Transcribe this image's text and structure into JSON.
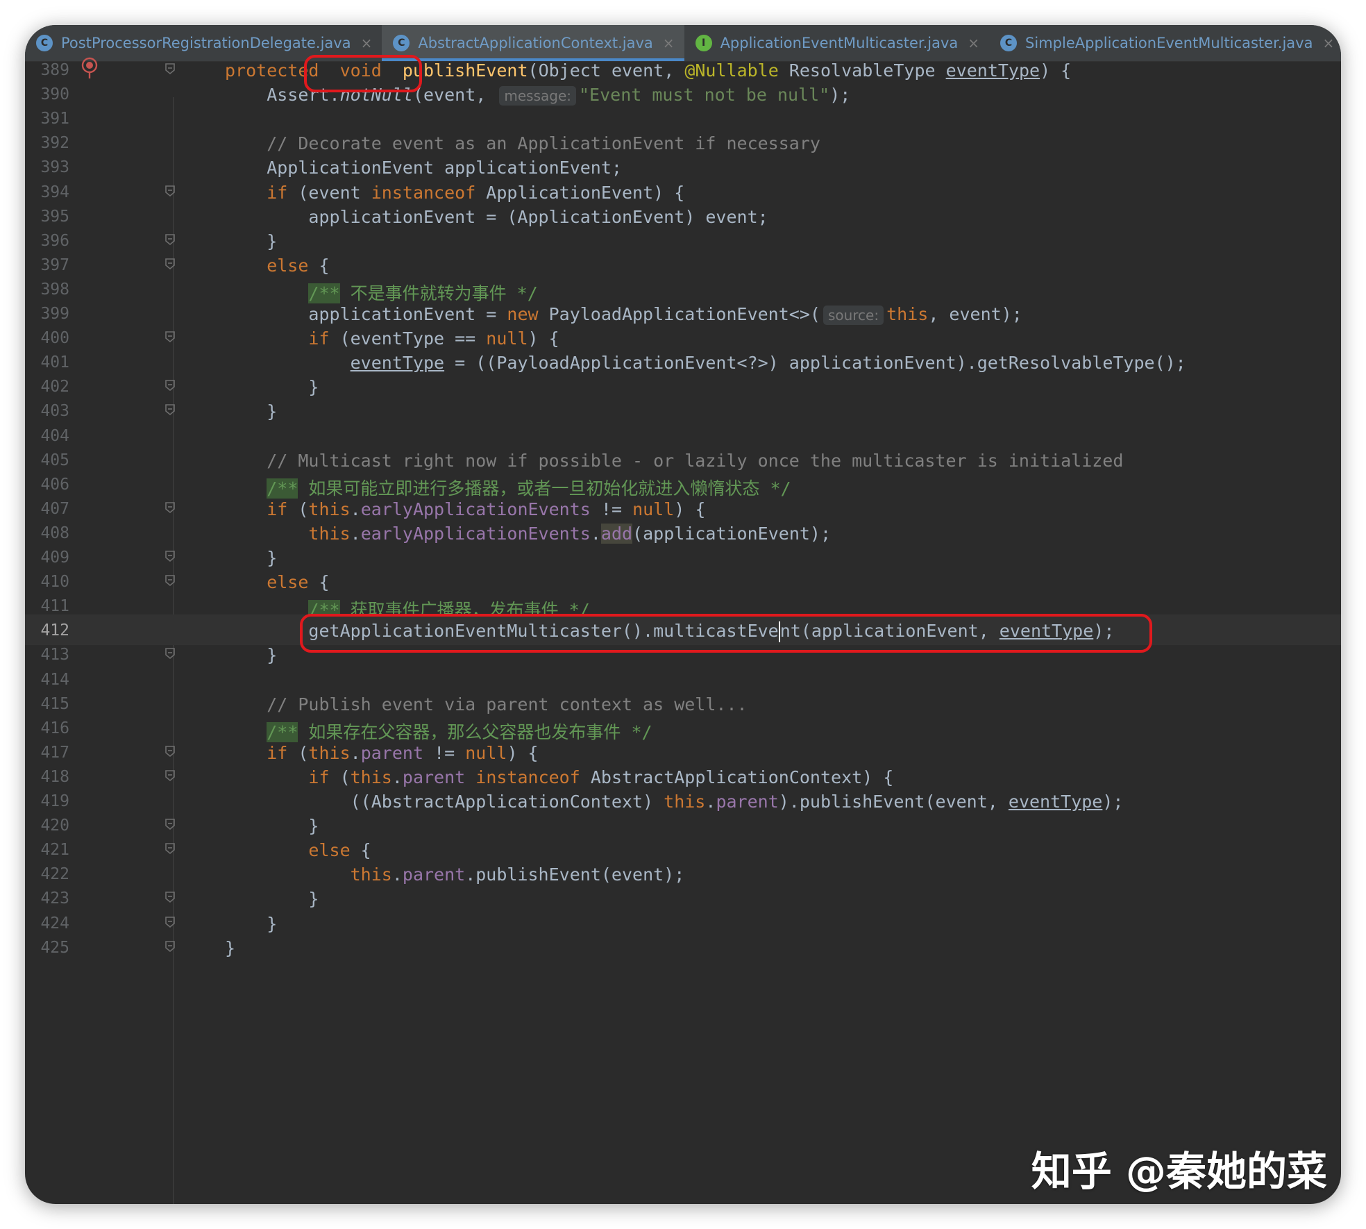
{
  "tabs": [
    {
      "label": "PostProcessorRegistrationDelegate.java",
      "icon": "class-icon",
      "active": false
    },
    {
      "label": "AbstractApplicationContext.java",
      "icon": "class-icon",
      "active": true
    },
    {
      "label": "ApplicationEventMulticaster.java",
      "icon": "interface-icon",
      "active": false
    },
    {
      "label": "SimpleApplicationEventMulticaster.java",
      "icon": "class-icon",
      "active": false
    }
  ],
  "tab_close_glyph": "×",
  "current_line": 412,
  "lines": [
    {
      "n": 389,
      "tokens": [
        [
          "kw",
          "protected"
        ],
        [
          "",
          "  "
        ],
        [
          "kw",
          "void"
        ],
        [
          "",
          "  "
        ],
        [
          "fn",
          "publishEvent"
        ],
        [
          "",
          "(Object event, "
        ],
        [
          "ann",
          "@Nullable"
        ],
        [
          "",
          " ResolvableType "
        ],
        [
          "ul",
          "eventType"
        ],
        [
          "",
          ") {"
        ]
      ]
    },
    {
      "n": 390,
      "tokens": [
        [
          "",
          "    Assert."
        ],
        [
          "it",
          "notNull"
        ],
        [
          "",
          "(event, "
        ],
        [
          "hint",
          "message:"
        ],
        [
          "str",
          "\"Event must not be null\""
        ],
        [
          "",
          ");"
        ]
      ]
    },
    {
      "n": 391,
      "tokens": []
    },
    {
      "n": 392,
      "tokens": [
        [
          "cm",
          "    // Decorate event as an ApplicationEvent if necessary"
        ]
      ]
    },
    {
      "n": 393,
      "tokens": [
        [
          "",
          "    ApplicationEvent applicationEvent;"
        ]
      ]
    },
    {
      "n": 394,
      "tokens": [
        [
          "kw",
          "    if"
        ],
        [
          "",
          " (event "
        ],
        [
          "kw",
          "instanceof"
        ],
        [
          "",
          " ApplicationEvent) {"
        ]
      ]
    },
    {
      "n": 395,
      "tokens": [
        [
          "",
          "        applicationEvent = (ApplicationEvent) event;"
        ]
      ]
    },
    {
      "n": 396,
      "tokens": [
        [
          "",
          "    }"
        ]
      ]
    },
    {
      "n": 397,
      "tokens": [
        [
          "kw",
          "    else"
        ],
        [
          "",
          " {"
        ]
      ]
    },
    {
      "n": 398,
      "tokens": [
        [
          "",
          "        "
        ],
        [
          "docstart",
          "/**"
        ],
        [
          "doc",
          " 不是事件就转为事件 */"
        ]
      ]
    },
    {
      "n": 399,
      "tokens": [
        [
          "",
          "        applicationEvent = "
        ],
        [
          "kw",
          "new"
        ],
        [
          "",
          " PayloadApplicationEvent<>("
        ],
        [
          "hint",
          "source:"
        ],
        [
          "kw",
          "this"
        ],
        [
          "",
          ", event);"
        ]
      ]
    },
    {
      "n": 400,
      "tokens": [
        [
          "kw",
          "        if"
        ],
        [
          "",
          " (eventType == "
        ],
        [
          "kw",
          "null"
        ],
        [
          "",
          ") {"
        ]
      ]
    },
    {
      "n": 401,
      "tokens": [
        [
          "",
          "            "
        ],
        [
          "ul",
          "eventType"
        ],
        [
          "",
          " = ((PayloadApplicationEvent<?>) applicationEvent).getResolvableType();"
        ]
      ]
    },
    {
      "n": 402,
      "tokens": [
        [
          "",
          "        }"
        ]
      ]
    },
    {
      "n": 403,
      "tokens": [
        [
          "",
          "    }"
        ]
      ]
    },
    {
      "n": 404,
      "tokens": []
    },
    {
      "n": 405,
      "tokens": [
        [
          "cm",
          "    // Multicast right now if possible - or lazily once the multicaster is initialized"
        ]
      ]
    },
    {
      "n": 406,
      "tokens": [
        [
          "",
          "    "
        ],
        [
          "docstart",
          "/**"
        ],
        [
          "doc",
          " 如果可能立即进行多播器，或者一旦初始化就进入懒惰状态 */"
        ]
      ]
    },
    {
      "n": 407,
      "tokens": [
        [
          "kw",
          "    if"
        ],
        [
          "",
          " ("
        ],
        [
          "kw",
          "this"
        ],
        [
          "",
          "."
        ],
        [
          "fld",
          "earlyApplicationEvents"
        ],
        [
          "",
          " != "
        ],
        [
          "kw",
          "null"
        ],
        [
          "",
          ") {"
        ]
      ]
    },
    {
      "n": 408,
      "tokens": [
        [
          "kw",
          "        this"
        ],
        [
          "",
          "."
        ],
        [
          "fld",
          "earlyApplicationEvents"
        ],
        [
          "",
          "."
        ],
        [
          "hladd",
          "add"
        ],
        [
          "",
          "(applicationEvent);"
        ]
      ]
    },
    {
      "n": 409,
      "tokens": [
        [
          "",
          "    }"
        ]
      ]
    },
    {
      "n": 410,
      "tokens": [
        [
          "kw",
          "    else"
        ],
        [
          "",
          " {"
        ]
      ]
    },
    {
      "n": 411,
      "tokens": [
        [
          "",
          "        "
        ],
        [
          "docstart",
          "/**"
        ],
        [
          "doc",
          " 获取事件广播器，发布事件 */"
        ]
      ]
    },
    {
      "n": 412,
      "tokens": [
        [
          "",
          "        getApplicationEventMulticaster().multicastEve"
        ],
        [
          "caret",
          ""
        ],
        [
          "",
          "nt(applicationEvent, "
        ],
        [
          "ul",
          "eventType"
        ],
        [
          "",
          ");"
        ]
      ]
    },
    {
      "n": 413,
      "tokens": [
        [
          "",
          "    }"
        ]
      ]
    },
    {
      "n": 414,
      "tokens": []
    },
    {
      "n": 415,
      "tokens": [
        [
          "cm",
          "    // Publish event via parent context as well..."
        ]
      ]
    },
    {
      "n": 416,
      "tokens": [
        [
          "",
          "    "
        ],
        [
          "docstart",
          "/**"
        ],
        [
          "doc",
          " 如果存在父容器，那么父容器也发布事件 */"
        ]
      ]
    },
    {
      "n": 417,
      "tokens": [
        [
          "kw",
          "    if"
        ],
        [
          "",
          " ("
        ],
        [
          "kw",
          "this"
        ],
        [
          "",
          "."
        ],
        [
          "fld",
          "parent"
        ],
        [
          "",
          " != "
        ],
        [
          "kw",
          "null"
        ],
        [
          "",
          ") {"
        ]
      ]
    },
    {
      "n": 418,
      "tokens": [
        [
          "kw",
          "        if"
        ],
        [
          "",
          " ("
        ],
        [
          "kw",
          "this"
        ],
        [
          "",
          "."
        ],
        [
          "fld",
          "parent"
        ],
        [
          " ",
          ""
        ],
        [
          "kw",
          " instanceof"
        ],
        [
          "",
          " AbstractApplicationContext) {"
        ]
      ]
    },
    {
      "n": 419,
      "tokens": [
        [
          "",
          "            ((AbstractApplicationContext) "
        ],
        [
          "kw",
          "this"
        ],
        [
          "",
          "."
        ],
        [
          "fld",
          "parent"
        ],
        [
          "",
          ").publishEvent(event, "
        ],
        [
          "ul",
          "eventType"
        ],
        [
          "",
          ");"
        ]
      ]
    },
    {
      "n": 420,
      "tokens": [
        [
          "",
          "        }"
        ]
      ]
    },
    {
      "n": 421,
      "tokens": [
        [
          "kw",
          "        else"
        ],
        [
          "",
          " {"
        ]
      ]
    },
    {
      "n": 422,
      "tokens": [
        [
          "kw",
          "            this"
        ],
        [
          "",
          "."
        ],
        [
          "fld",
          "parent"
        ],
        [
          "",
          ".publishEvent(event);"
        ]
      ]
    },
    {
      "n": 423,
      "tokens": [
        [
          "",
          "        }"
        ]
      ]
    },
    {
      "n": 424,
      "tokens": [
        [
          "",
          "    }"
        ]
      ]
    },
    {
      "n": 425,
      "tokens": [
        [
          "",
          "}"
        ]
      ]
    }
  ],
  "fold_lines": [
    389,
    394,
    396,
    397,
    400,
    402,
    403,
    407,
    409,
    410,
    413,
    417,
    418,
    420,
    421,
    423,
    424,
    425
  ],
  "watermark": "知乎 @秦她的菜",
  "colors": {
    "background": "#2b2b2b",
    "keyword": "#cc7832",
    "method": "#ffc66d",
    "string": "#6a8759",
    "comment": "#808080",
    "doc_comment": "#629755",
    "field": "#9876aa",
    "annotation": "#bbb529",
    "highlight_box": "#e0191d"
  }
}
